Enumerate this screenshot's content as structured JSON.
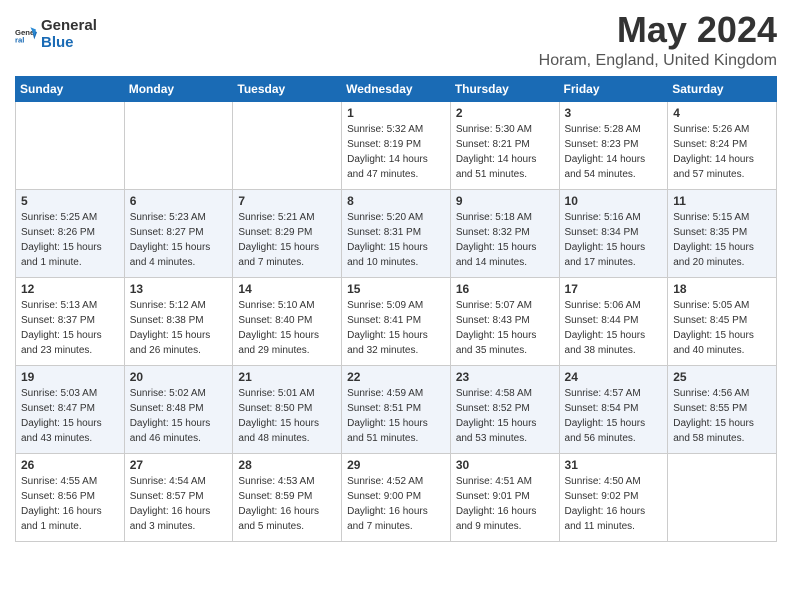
{
  "header": {
    "logo_general": "General",
    "logo_blue": "Blue",
    "month_title": "May 2024",
    "location": "Horam, England, United Kingdom"
  },
  "days_of_week": [
    "Sunday",
    "Monday",
    "Tuesday",
    "Wednesday",
    "Thursday",
    "Friday",
    "Saturday"
  ],
  "weeks": [
    [
      {
        "day": "",
        "info": ""
      },
      {
        "day": "",
        "info": ""
      },
      {
        "day": "",
        "info": ""
      },
      {
        "day": "1",
        "info": "Sunrise: 5:32 AM\nSunset: 8:19 PM\nDaylight: 14 hours\nand 47 minutes."
      },
      {
        "day": "2",
        "info": "Sunrise: 5:30 AM\nSunset: 8:21 PM\nDaylight: 14 hours\nand 51 minutes."
      },
      {
        "day": "3",
        "info": "Sunrise: 5:28 AM\nSunset: 8:23 PM\nDaylight: 14 hours\nand 54 minutes."
      },
      {
        "day": "4",
        "info": "Sunrise: 5:26 AM\nSunset: 8:24 PM\nDaylight: 14 hours\nand 57 minutes."
      }
    ],
    [
      {
        "day": "5",
        "info": "Sunrise: 5:25 AM\nSunset: 8:26 PM\nDaylight: 15 hours\nand 1 minute."
      },
      {
        "day": "6",
        "info": "Sunrise: 5:23 AM\nSunset: 8:27 PM\nDaylight: 15 hours\nand 4 minutes."
      },
      {
        "day": "7",
        "info": "Sunrise: 5:21 AM\nSunset: 8:29 PM\nDaylight: 15 hours\nand 7 minutes."
      },
      {
        "day": "8",
        "info": "Sunrise: 5:20 AM\nSunset: 8:31 PM\nDaylight: 15 hours\nand 10 minutes."
      },
      {
        "day": "9",
        "info": "Sunrise: 5:18 AM\nSunset: 8:32 PM\nDaylight: 15 hours\nand 14 minutes."
      },
      {
        "day": "10",
        "info": "Sunrise: 5:16 AM\nSunset: 8:34 PM\nDaylight: 15 hours\nand 17 minutes."
      },
      {
        "day": "11",
        "info": "Sunrise: 5:15 AM\nSunset: 8:35 PM\nDaylight: 15 hours\nand 20 minutes."
      }
    ],
    [
      {
        "day": "12",
        "info": "Sunrise: 5:13 AM\nSunset: 8:37 PM\nDaylight: 15 hours\nand 23 minutes."
      },
      {
        "day": "13",
        "info": "Sunrise: 5:12 AM\nSunset: 8:38 PM\nDaylight: 15 hours\nand 26 minutes."
      },
      {
        "day": "14",
        "info": "Sunrise: 5:10 AM\nSunset: 8:40 PM\nDaylight: 15 hours\nand 29 minutes."
      },
      {
        "day": "15",
        "info": "Sunrise: 5:09 AM\nSunset: 8:41 PM\nDaylight: 15 hours\nand 32 minutes."
      },
      {
        "day": "16",
        "info": "Sunrise: 5:07 AM\nSunset: 8:43 PM\nDaylight: 15 hours\nand 35 minutes."
      },
      {
        "day": "17",
        "info": "Sunrise: 5:06 AM\nSunset: 8:44 PM\nDaylight: 15 hours\nand 38 minutes."
      },
      {
        "day": "18",
        "info": "Sunrise: 5:05 AM\nSunset: 8:45 PM\nDaylight: 15 hours\nand 40 minutes."
      }
    ],
    [
      {
        "day": "19",
        "info": "Sunrise: 5:03 AM\nSunset: 8:47 PM\nDaylight: 15 hours\nand 43 minutes."
      },
      {
        "day": "20",
        "info": "Sunrise: 5:02 AM\nSunset: 8:48 PM\nDaylight: 15 hours\nand 46 minutes."
      },
      {
        "day": "21",
        "info": "Sunrise: 5:01 AM\nSunset: 8:50 PM\nDaylight: 15 hours\nand 48 minutes."
      },
      {
        "day": "22",
        "info": "Sunrise: 4:59 AM\nSunset: 8:51 PM\nDaylight: 15 hours\nand 51 minutes."
      },
      {
        "day": "23",
        "info": "Sunrise: 4:58 AM\nSunset: 8:52 PM\nDaylight: 15 hours\nand 53 minutes."
      },
      {
        "day": "24",
        "info": "Sunrise: 4:57 AM\nSunset: 8:54 PM\nDaylight: 15 hours\nand 56 minutes."
      },
      {
        "day": "25",
        "info": "Sunrise: 4:56 AM\nSunset: 8:55 PM\nDaylight: 15 hours\nand 58 minutes."
      }
    ],
    [
      {
        "day": "26",
        "info": "Sunrise: 4:55 AM\nSunset: 8:56 PM\nDaylight: 16 hours\nand 1 minute."
      },
      {
        "day": "27",
        "info": "Sunrise: 4:54 AM\nSunset: 8:57 PM\nDaylight: 16 hours\nand 3 minutes."
      },
      {
        "day": "28",
        "info": "Sunrise: 4:53 AM\nSunset: 8:59 PM\nDaylight: 16 hours\nand 5 minutes."
      },
      {
        "day": "29",
        "info": "Sunrise: 4:52 AM\nSunset: 9:00 PM\nDaylight: 16 hours\nand 7 minutes."
      },
      {
        "day": "30",
        "info": "Sunrise: 4:51 AM\nSunset: 9:01 PM\nDaylight: 16 hours\nand 9 minutes."
      },
      {
        "day": "31",
        "info": "Sunrise: 4:50 AM\nSunset: 9:02 PM\nDaylight: 16 hours\nand 11 minutes."
      },
      {
        "day": "",
        "info": ""
      }
    ]
  ]
}
